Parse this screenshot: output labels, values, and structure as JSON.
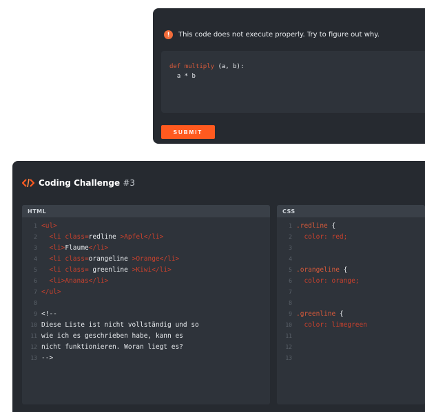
{
  "top_card": {
    "notice": "This code does not execute properly. Try to figure out why.",
    "notice_icon": "exclamation-icon",
    "code_lines": [
      {
        "kw": "def",
        "fn": "multiply",
        "rest": " (a, b):"
      },
      {
        "kw": "",
        "fn": "",
        "rest": "  a * b"
      }
    ],
    "submit_label": "SUBMIT"
  },
  "challenge": {
    "title": "Coding Challenge",
    "number": "#3",
    "html_label": "HTML",
    "css_label": "CSS"
  },
  "html_lines": [
    {
      "n": "1",
      "parts": [
        [
          "tag",
          "<ul>"
        ]
      ]
    },
    {
      "n": "2",
      "parts": [
        [
          "white",
          "  "
        ],
        [
          "tag",
          "<li "
        ],
        [
          "attr",
          "class="
        ],
        [
          "white",
          "redline "
        ],
        [
          "str",
          ">Apfel</li>"
        ]
      ]
    },
    {
      "n": "3",
      "parts": [
        [
          "white",
          "  "
        ],
        [
          "tag",
          "<li>"
        ],
        [
          "white",
          "Flaume"
        ],
        [
          "tag",
          "</li>"
        ]
      ]
    },
    {
      "n": "4",
      "parts": [
        [
          "white",
          "  "
        ],
        [
          "tag",
          "<li "
        ],
        [
          "attr",
          "class="
        ],
        [
          "white",
          "orangeline "
        ],
        [
          "str",
          ">Orange</li>"
        ]
      ]
    },
    {
      "n": "5",
      "parts": [
        [
          "white",
          "  "
        ],
        [
          "tag",
          "<li "
        ],
        [
          "attr",
          "class="
        ],
        [
          "white",
          " greenline "
        ],
        [
          "str",
          ">Kiwi</li>"
        ]
      ]
    },
    {
      "n": "6",
      "parts": [
        [
          "white",
          "  "
        ],
        [
          "tag",
          "<li>Ananas</li>"
        ]
      ]
    },
    {
      "n": "7",
      "parts": [
        [
          "tag",
          "</ul>"
        ]
      ]
    },
    {
      "n": "8",
      "parts": [
        [
          "white",
          ""
        ]
      ]
    },
    {
      "n": "9",
      "parts": [
        [
          "white",
          "<!--"
        ]
      ]
    },
    {
      "n": "10",
      "parts": [
        [
          "white",
          "Diese Liste ist nicht vollständig und so"
        ]
      ]
    },
    {
      "n": "11",
      "parts": [
        [
          "white",
          "wie ich es geschrieben habe, kann es"
        ]
      ]
    },
    {
      "n": "12",
      "parts": [
        [
          "white",
          "nicht funktionieren. Woran liegt es?"
        ]
      ]
    },
    {
      "n": "13",
      "parts": [
        [
          "white",
          "-->"
        ]
      ]
    }
  ],
  "css_lines": [
    {
      "n": "1",
      "parts": [
        [
          "sel",
          ".redline "
        ],
        [
          "white",
          "{"
        ]
      ]
    },
    {
      "n": "2",
      "parts": [
        [
          "prop",
          "  color: "
        ],
        [
          "val",
          "red;"
        ]
      ]
    },
    {
      "n": "3",
      "parts": [
        [
          "white",
          ""
        ]
      ]
    },
    {
      "n": "4",
      "parts": [
        [
          "white",
          ""
        ]
      ]
    },
    {
      "n": "5",
      "parts": [
        [
          "sel",
          ".orangeline "
        ],
        [
          "white",
          "{"
        ]
      ]
    },
    {
      "n": "6",
      "parts": [
        [
          "prop",
          "  color: "
        ],
        [
          "val",
          "orange;"
        ]
      ]
    },
    {
      "n": "7",
      "parts": [
        [
          "white",
          ""
        ]
      ]
    },
    {
      "n": "8",
      "parts": [
        [
          "white",
          ""
        ]
      ]
    },
    {
      "n": "9",
      "parts": [
        [
          "sel",
          ".greenline "
        ],
        [
          "white",
          "{"
        ]
      ]
    },
    {
      "n": "10",
      "parts": [
        [
          "prop",
          "  color: "
        ],
        [
          "val",
          "limegreen"
        ]
      ]
    },
    {
      "n": "11",
      "parts": [
        [
          "white",
          ""
        ]
      ]
    },
    {
      "n": "12",
      "parts": [
        [
          "white",
          ""
        ]
      ]
    },
    {
      "n": "13",
      "parts": [
        [
          "white",
          ""
        ]
      ]
    }
  ],
  "colors": {
    "accent": "#ff5a1f",
    "card_bg": "#262a30",
    "panel_bg": "#2e333a",
    "syntax_red": "#c9412d"
  }
}
